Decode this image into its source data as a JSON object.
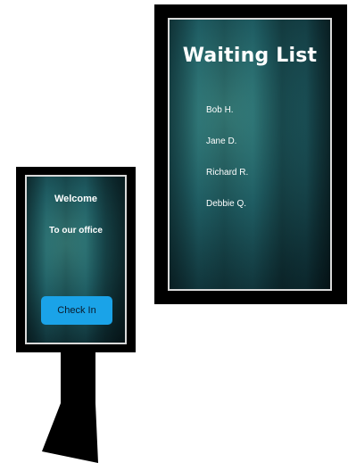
{
  "wall_display": {
    "title": "Waiting List",
    "names": [
      "Bob H.",
      "Jane D.",
      "Richard R.",
      "Debbie Q."
    ]
  },
  "kiosk": {
    "welcome": "Welcome",
    "subtitle": "To our office",
    "button_label": "Check In"
  },
  "colors": {
    "bezel": "#000000",
    "screen_teal": "#1f5d63",
    "button_blue": "#1aa3e8"
  }
}
